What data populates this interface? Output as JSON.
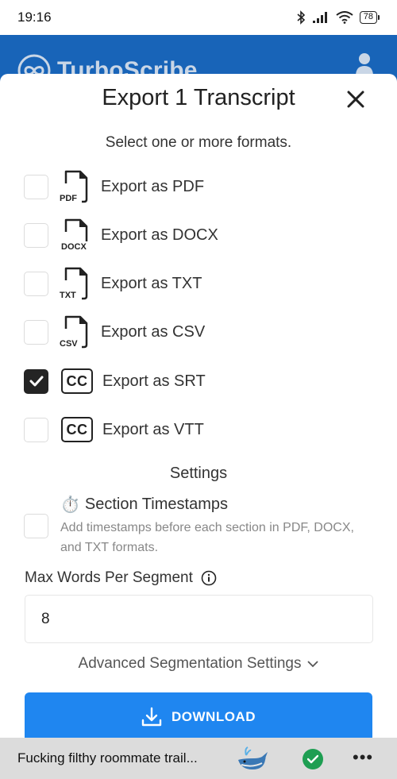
{
  "status_bar": {
    "time": "19:16",
    "battery": "78"
  },
  "app": {
    "brand": "TurboScribe"
  },
  "modal": {
    "title": "Export 1 Transcript",
    "subtitle": "Select one or more formats.",
    "formats": [
      {
        "label": "Export as PDF",
        "icon": "file-icon",
        "ext": "PDF",
        "checked": false
      },
      {
        "label": "Export as DOCX",
        "icon": "file-icon",
        "ext": "DOCX",
        "checked": false
      },
      {
        "label": "Export as TXT",
        "icon": "file-icon",
        "ext": "TXT",
        "checked": false
      },
      {
        "label": "Export as CSV",
        "icon": "file-icon",
        "ext": "CSV",
        "checked": false
      },
      {
        "label": "Export as SRT",
        "icon": "cc-icon",
        "ext": "CC",
        "checked": true
      },
      {
        "label": "Export as VTT",
        "icon": "cc-icon",
        "ext": "CC",
        "checked": false
      }
    ],
    "settings_title": "Settings",
    "section_timestamps": {
      "title": "Section Timestamps",
      "emoji": "⏱️",
      "description": "Add timestamps before each section in PDF, DOCX, and TXT formats.",
      "checked": false
    },
    "max_words": {
      "label": "Max Words Per Segment",
      "value": "8"
    },
    "advanced_link": "Advanced Segmentation Settings",
    "download_label": "DOWNLOAD"
  },
  "bottom_bar": {
    "track_title": "Fucking filthy roommate trail..."
  },
  "colors": {
    "appbar": "#1864b8",
    "download": "#1f86f0",
    "success": "#1e9e52"
  }
}
